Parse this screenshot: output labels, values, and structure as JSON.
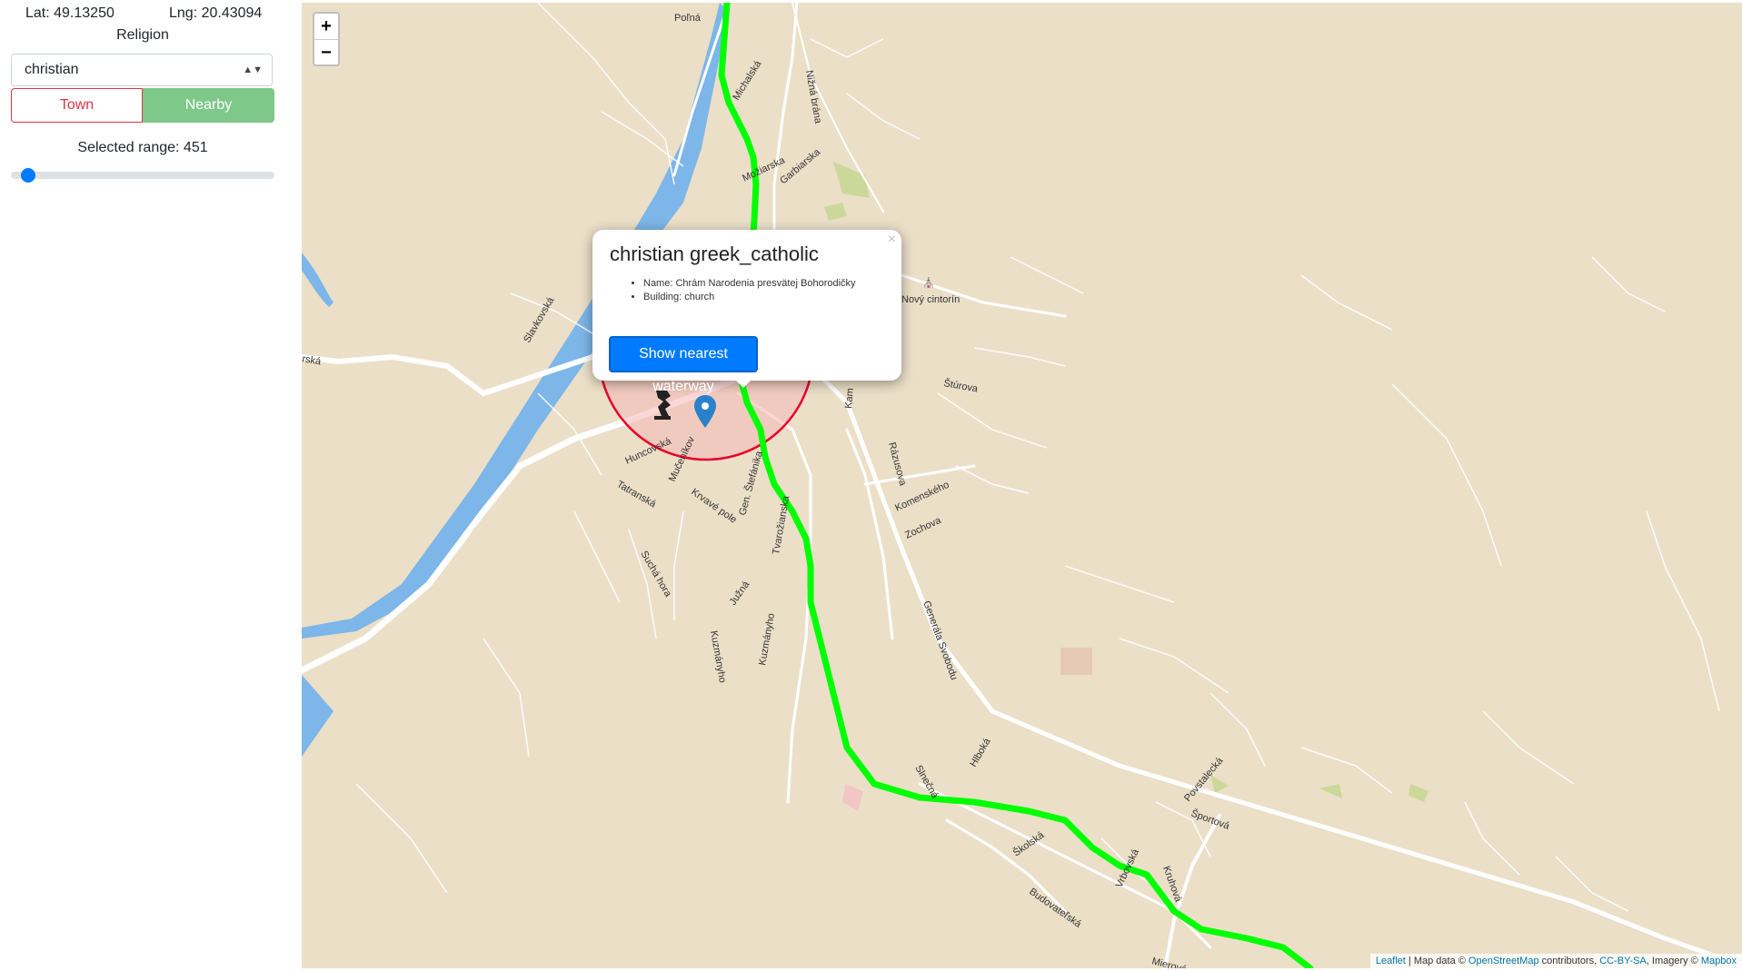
{
  "sidebar": {
    "lat_label": "Lat: 49.13250",
    "lng_label": "Lng: 20.43094",
    "religion_label": "Religion",
    "religion_select_value": "christian",
    "town_button": "Town",
    "nearby_button": "Nearby",
    "range_label": "Selected range: 451",
    "range_value": 451
  },
  "map": {
    "zoom_in": "+",
    "zoom_out": "−",
    "streets": {
      "polna": "Poľná",
      "michalska": "Michalská",
      "nizna_brana": "Nižná brána",
      "mozjarska": "Možiarska",
      "garbiarska": "Garbiarska",
      "slavkovska": "Slavkovská",
      "ska": "rská",
      "novy_cintorin": "Nový cintorín",
      "sturova": "Štúrova",
      "hunc": "Huncovská",
      "mucenikov": "Mučeníkov",
      "tatranska": "Tatranská",
      "krvave_pole": "Krvavé pole",
      "gen_stefanika": "Gen. Štefánika",
      "tvarozianska": "Tvarožianska",
      "razusova": "Rázusova",
      "komenskeho": "Komenského",
      "zochova": "Zochova",
      "sucha_hora": "Suchá hora",
      "juzna": "Južná",
      "kuzmanyho1": "Kuzmányho",
      "kuzmanyho2": "Kuzmányho",
      "generala_svobodu": "Generála Svobodu",
      "hlboka": "Hlboká",
      "slnecna": "Slnečná",
      "povstalecka": "Povstalecká",
      "sportova": "Športová",
      "skolska": "Školská",
      "vrbovska": "Vrbovská",
      "kruhova": "Kruhová",
      "budovatelska": "Budovateľská",
      "mierova": "Mierová",
      "kam": "Kam"
    },
    "popup": {
      "title": "christian greek_catholic",
      "close": "×",
      "items": [
        "Name: Chrám Narodenia presvätej Bohorodičky",
        "Building: church"
      ],
      "button": "Show nearest waterway"
    },
    "attribution": {
      "leaflet": "Leaflet",
      "text1": " | Map data © ",
      "osm": "OpenStreetMap",
      "text2": " contributors, ",
      "license": "CC-BY-SA",
      "text3": ", Imagery © ",
      "mapbox": "Mapbox"
    }
  },
  "colors": {
    "water": "#7db6e8",
    "route": "#00ff00",
    "circle_stroke": "#e8002a",
    "circle_fill": "#f5b8b8",
    "land": "#ebdfc8",
    "accent": "#007bff",
    "nearby": "#7ec889",
    "town": "#dc3545"
  }
}
